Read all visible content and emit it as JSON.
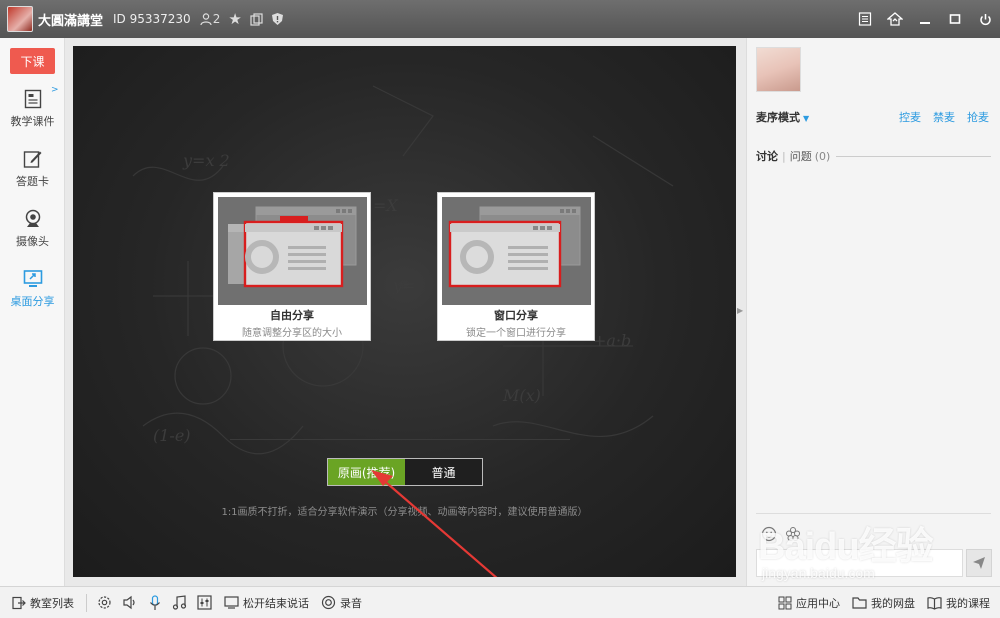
{
  "titlebar": {
    "class_name": "大圓滿講堂",
    "room_id": "ID 95337230",
    "user_count": "2"
  },
  "sidebar": {
    "end_class_label": "下课",
    "items": [
      {
        "label": "教学课件",
        "icon": "courseware-icon"
      },
      {
        "label": "答题卡",
        "icon": "answer-card-icon"
      },
      {
        "label": "摄像头",
        "icon": "camera-icon"
      },
      {
        "label": "桌面分享",
        "icon": "desktop-share-icon",
        "active": true
      }
    ]
  },
  "stage": {
    "cards": [
      {
        "title": "自由分享",
        "subtitle": "随意调整分享区的大小"
      },
      {
        "title": "窗口分享",
        "subtitle": "锁定一个窗口进行分享"
      }
    ],
    "mode_buttons": {
      "primary": "原画(推荐)",
      "secondary": "普通"
    },
    "hint": "1:1画质不打折，适合分享软件演示（分享视频、动画等内容时，建议使用普通版）"
  },
  "right_panel": {
    "mic_mode": "麦序模式",
    "actions": [
      "控麦",
      "禁麦",
      "抢麦"
    ],
    "tab_discussion": "讨论",
    "tab_questions": "问题",
    "question_count": "(0)"
  },
  "watermark": {
    "brand": "Baidu经验",
    "url": "jingyan.baidu.com"
  },
  "bottombar": {
    "classroom_list": "教室列表",
    "release_to_end": "松开结束说话",
    "record": "录音",
    "app_center": "应用中心",
    "my_drive": "我的网盘",
    "my_courses": "我的课程"
  },
  "colors": {
    "accent_blue": "#2d9be0",
    "end_class_red": "#ef5a4f",
    "recommend_green": "#6aa424",
    "highlight_red": "#d81e1e"
  }
}
